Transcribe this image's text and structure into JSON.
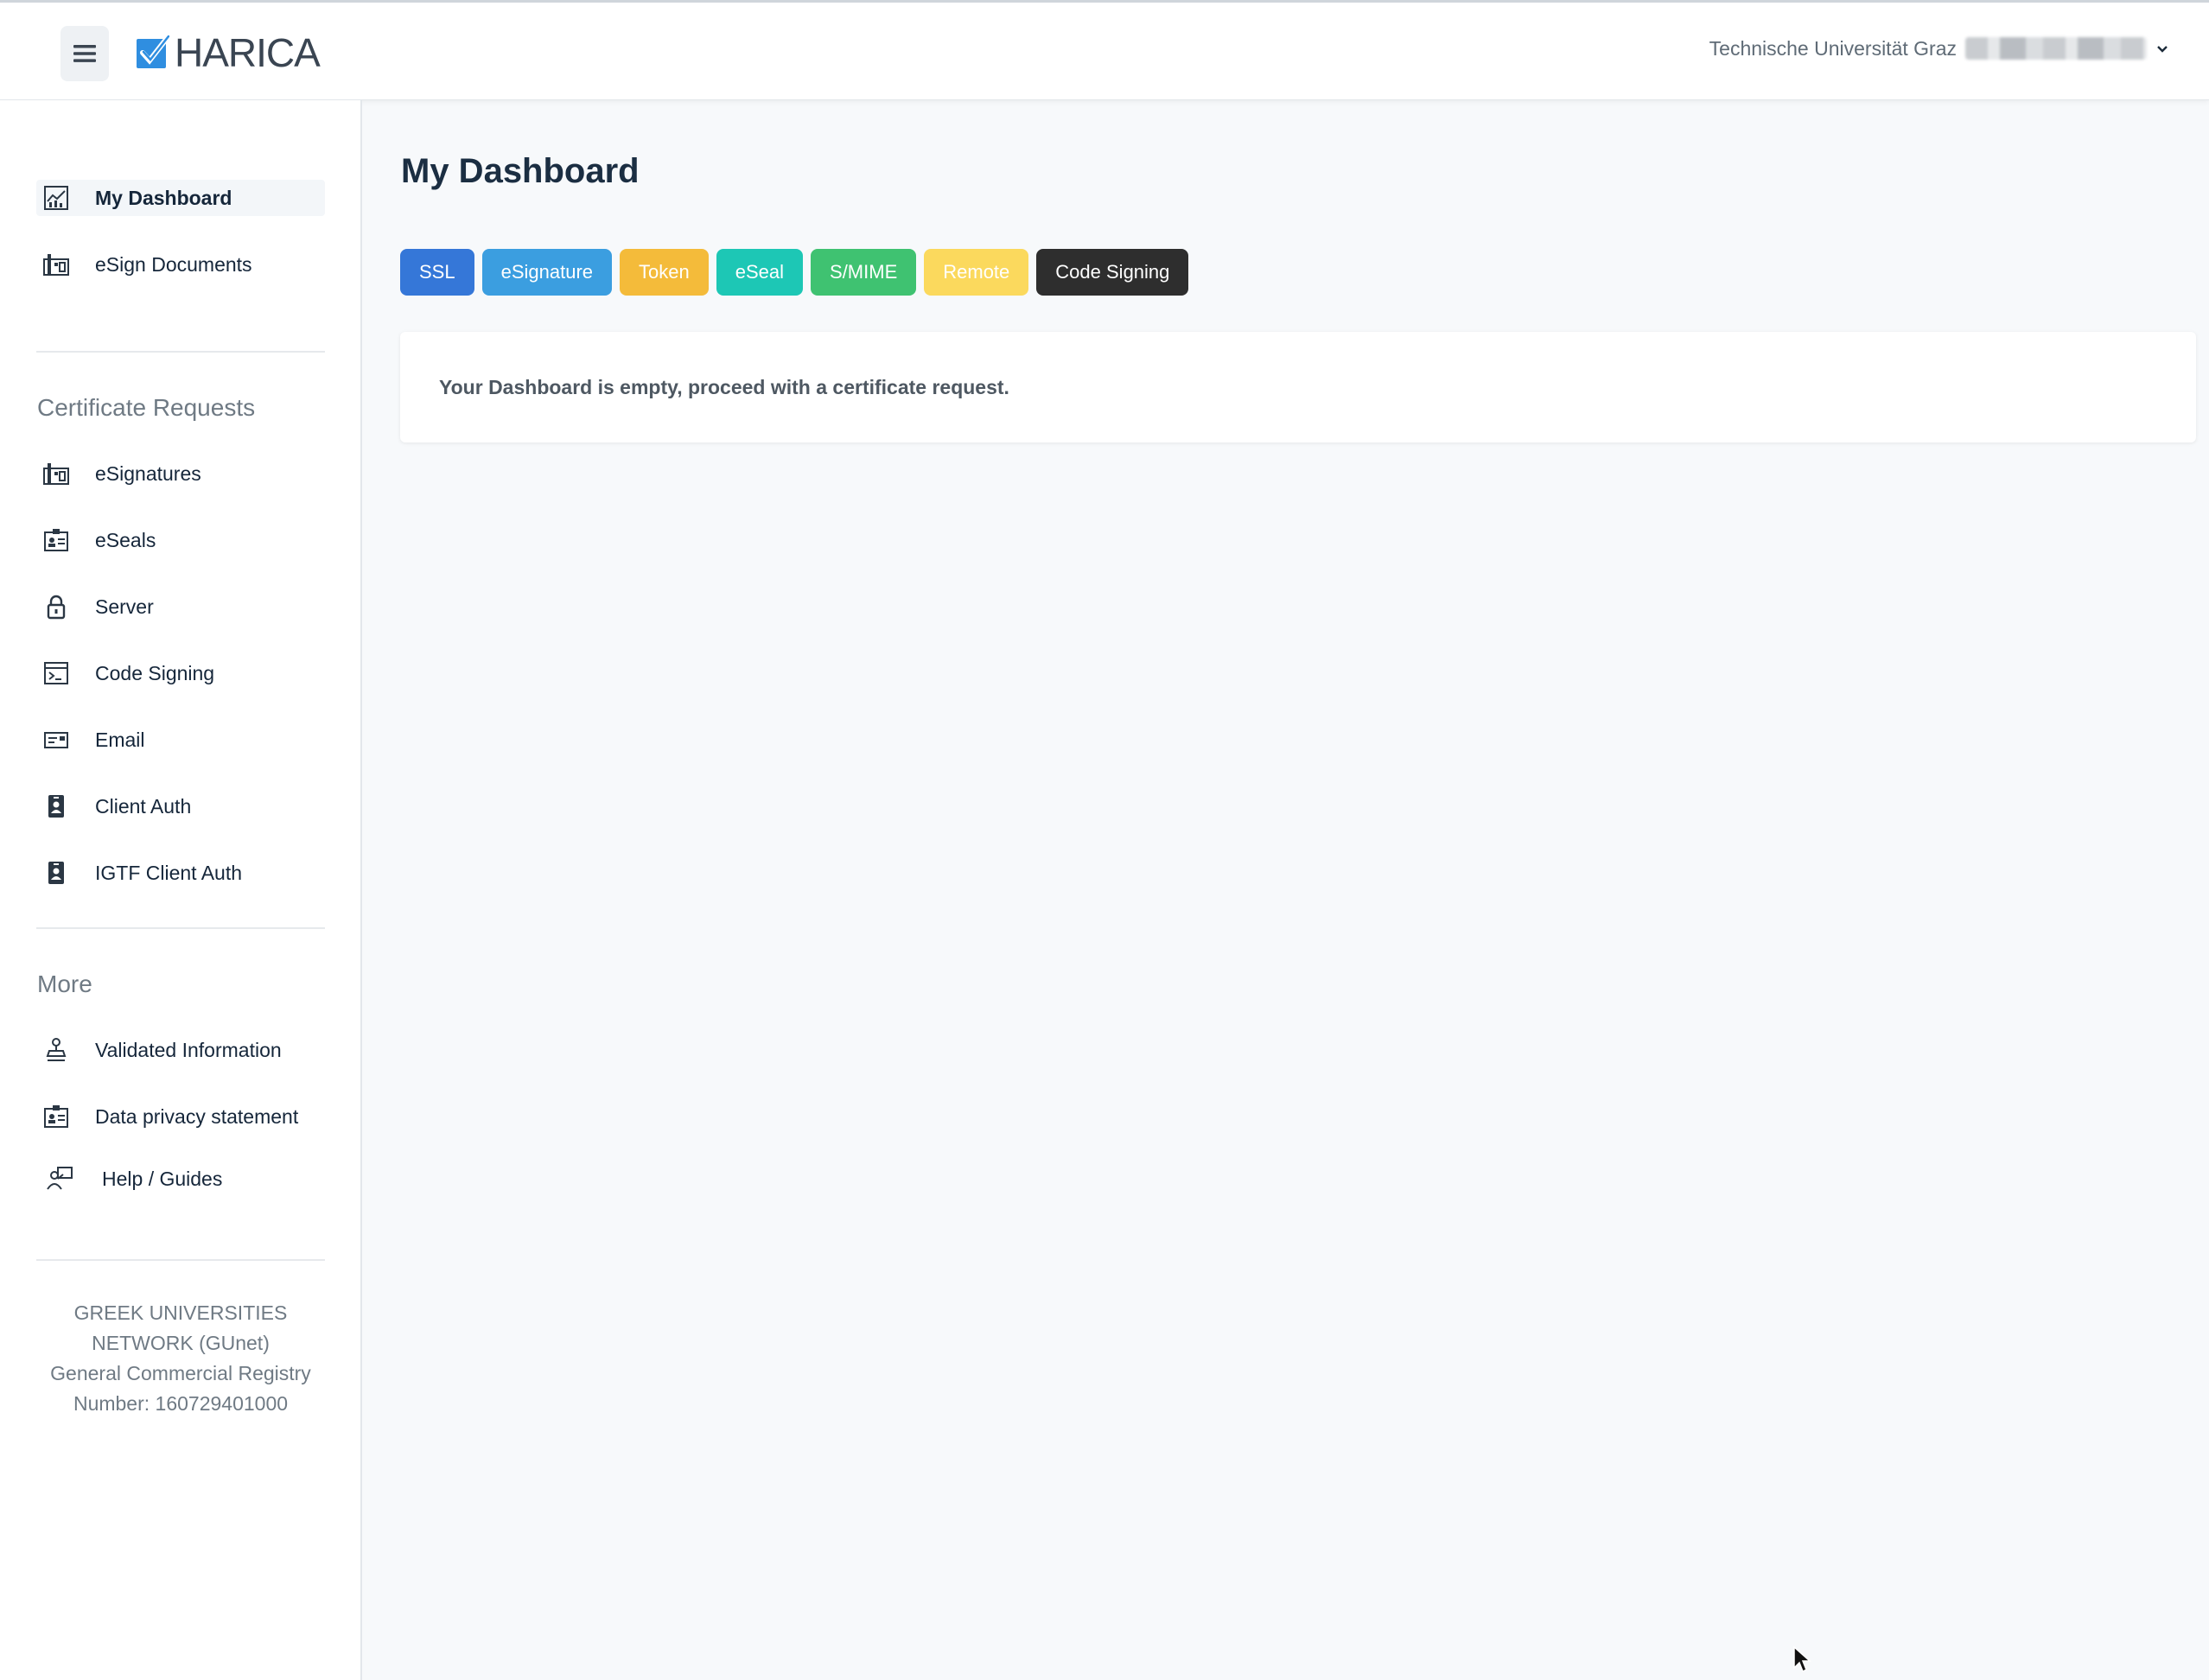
{
  "header": {
    "logo_text": "HARICA",
    "organization": "Technische Universität Graz"
  },
  "sidebar": {
    "top_items": [
      {
        "label": "My Dashboard",
        "icon": "chart-icon",
        "active": true
      },
      {
        "label": "eSign Documents",
        "icon": "esign-icon"
      }
    ],
    "certificate_requests": {
      "title": "Certificate Requests",
      "items": [
        {
          "label": "eSignatures",
          "icon": "esign-icon"
        },
        {
          "label": "eSeals",
          "icon": "id-card-icon"
        },
        {
          "label": "Server",
          "icon": "lock-icon"
        },
        {
          "label": "Code Signing",
          "icon": "terminal-icon"
        },
        {
          "label": "Email",
          "icon": "email-card-icon"
        },
        {
          "label": "Client Auth",
          "icon": "badge-icon"
        },
        {
          "label": "IGTF Client Auth",
          "icon": "badge-icon"
        }
      ]
    },
    "more": {
      "title": "More",
      "items": [
        {
          "label": "Validated Information",
          "icon": "stamp-icon"
        },
        {
          "label": "Data privacy statement",
          "icon": "id-card-icon"
        },
        {
          "label": "Help / Guides",
          "icon": "presenter-icon"
        }
      ]
    },
    "footer": {
      "line1": "GREEK UNIVERSITIES",
      "line2": "NETWORK (GUnet)",
      "line3": "General Commercial Registry",
      "line4": "Number: 160729401000"
    }
  },
  "main": {
    "title": "My Dashboard",
    "tabs": [
      {
        "label": "SSL",
        "color": "#3577d8"
      },
      {
        "label": "eSignature",
        "color": "#3b9ee0"
      },
      {
        "label": "Token",
        "color": "#f4bb3a"
      },
      {
        "label": "eSeal",
        "color": "#1dc7b5"
      },
      {
        "label": "S/MIME",
        "color": "#3fc271"
      },
      {
        "label": "Remote",
        "color": "#fbd95d"
      },
      {
        "label": "Code Signing",
        "color": "#2e2e2e"
      }
    ],
    "empty_message": "Your Dashboard is empty, proceed with a certificate request."
  }
}
